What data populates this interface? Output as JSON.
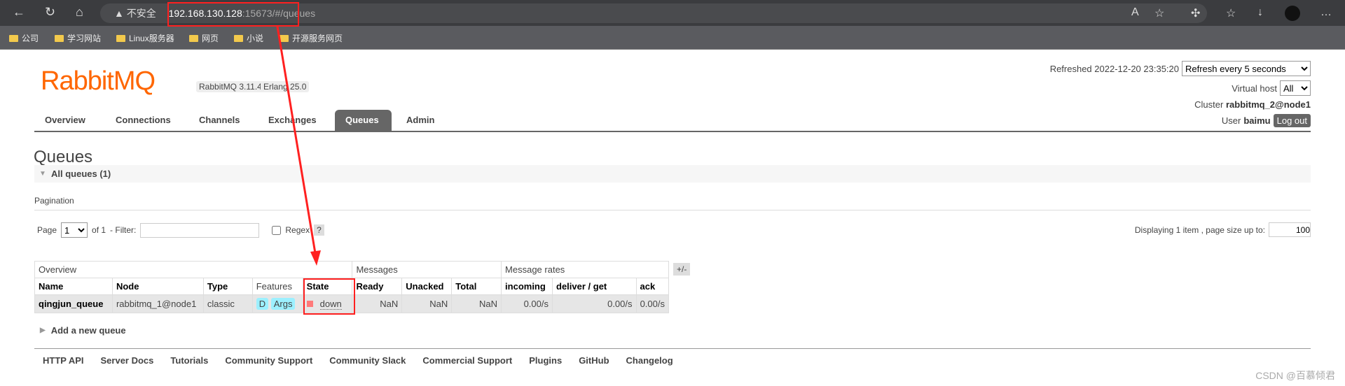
{
  "browser": {
    "insecure_label": "不安全",
    "url_host": "192.168.130.128",
    "url_rest": ":15673/#/queues",
    "bookmarks": [
      "公司",
      "学习网站",
      "Linux服务器",
      "网页",
      "小说",
      "开源服务网页"
    ]
  },
  "header": {
    "logo": "RabbitMQ",
    "version": "RabbitMQ 3.11.4",
    "erlang": "Erlang 25.0",
    "refreshed": "Refreshed 2022-12-20 23:35:20",
    "refresh_option": "Refresh every 5 seconds",
    "vhost_label": "Virtual host",
    "vhost_value": "All",
    "cluster_label": "Cluster",
    "cluster_value": "rabbitmq_2@node1",
    "user_label": "User",
    "user_value": "baimu",
    "logout": "Log out"
  },
  "tabs": [
    "Overview",
    "Connections",
    "Channels",
    "Exchanges",
    "Queues",
    "Admin"
  ],
  "page": {
    "title": "Queues",
    "section": "All queues (1)",
    "pagination": "Pagination",
    "page_label": "Page",
    "page_value": "1",
    "of": "of 1",
    "filter_label": "- Filter:",
    "regex": "Regex",
    "help": "?",
    "displaying": "Displaying 1 item , page size up to:",
    "page_size": "100"
  },
  "table": {
    "groups": [
      "Overview",
      "Messages",
      "Message rates"
    ],
    "toggle": "+/-",
    "columns": [
      "Name",
      "Node",
      "Type",
      "Features",
      "State",
      "Ready",
      "Unacked",
      "Total",
      "incoming",
      "deliver / get",
      "ack"
    ],
    "rows": [
      {
        "name": "qingjun_queue",
        "node": "rabbitmq_1@node1",
        "type": "classic",
        "features": [
          "D",
          "Args"
        ],
        "state": "down",
        "ready": "NaN",
        "unacked": "NaN",
        "total": "NaN",
        "incoming": "0.00/s",
        "deliver_get": "0.00/s",
        "ack": "0.00/s"
      }
    ]
  },
  "add_queue": "Add a new queue",
  "footer": [
    "HTTP API",
    "Server Docs",
    "Tutorials",
    "Community Support",
    "Community Slack",
    "Commercial Support",
    "Plugins",
    "GitHub",
    "Changelog"
  ],
  "watermark": "CSDN @百慕倾君",
  "colors": {
    "brand": "#ff6600",
    "state_down": "#ff7a7a",
    "annotation": "#ff2020"
  }
}
